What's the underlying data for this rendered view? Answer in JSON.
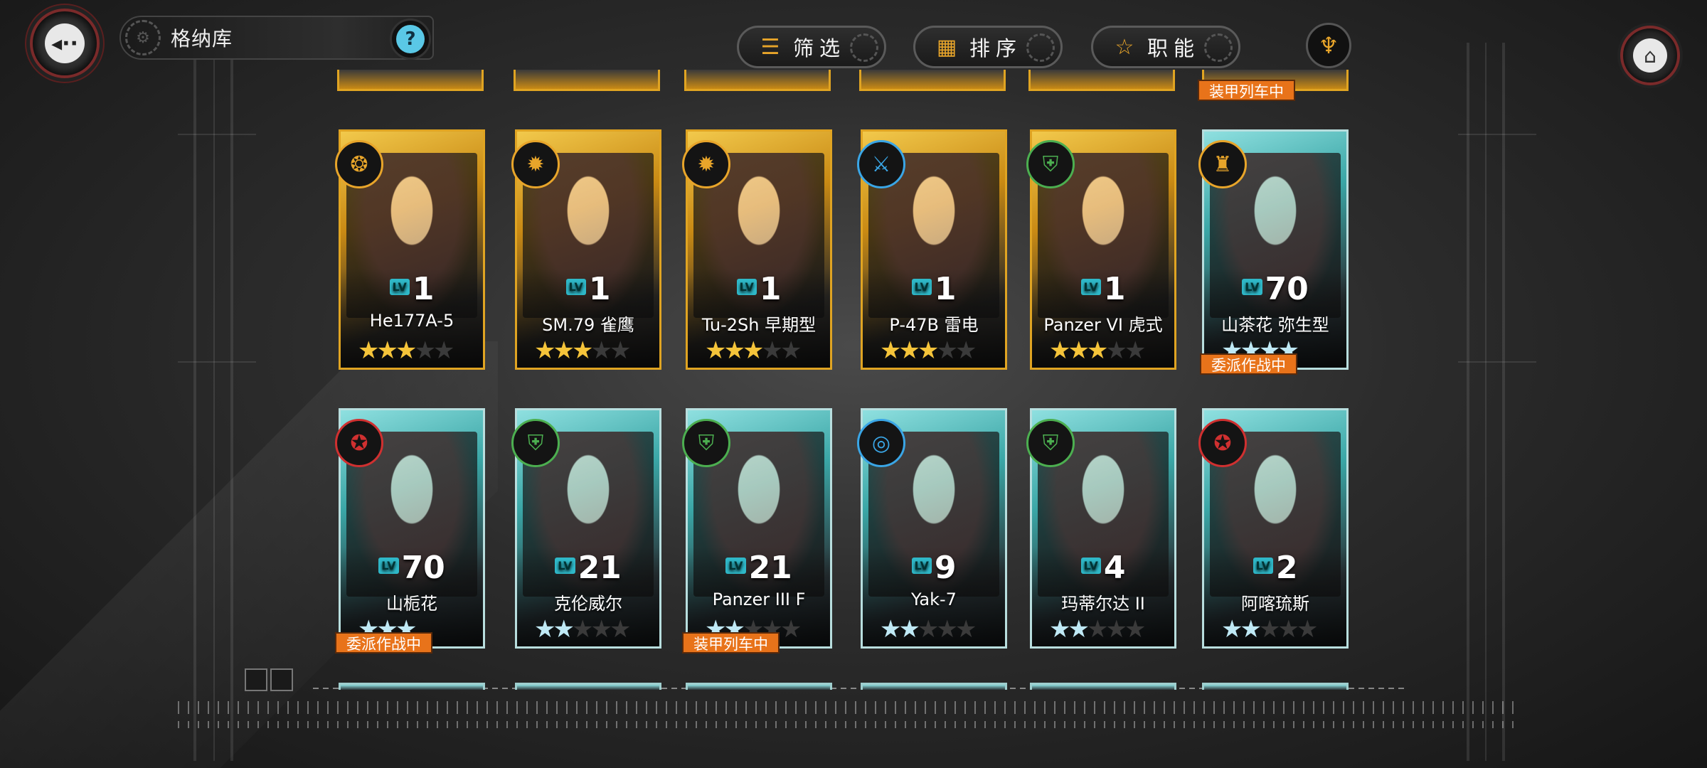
{
  "header": {
    "title": "格纳库",
    "help_label": "?",
    "filter_label": "筛选",
    "sort_label": "排序",
    "role_label": "职能"
  },
  "top_row_badge": "装甲列车中",
  "cards": [
    {
      "level": "1",
      "name": "He177A-5",
      "rarity": 3,
      "max": 5,
      "frame": "gold",
      "class_color": "#e8a52a",
      "class_icon": "❂"
    },
    {
      "level": "1",
      "name": "SM.79 雀鹰",
      "rarity": 3,
      "max": 5,
      "frame": "gold",
      "class_color": "#e8a52a",
      "class_icon": "✹"
    },
    {
      "level": "1",
      "name": "Tu-2Sh 早期型",
      "rarity": 3,
      "max": 5,
      "frame": "gold",
      "class_color": "#e8a52a",
      "class_icon": "✹"
    },
    {
      "level": "1",
      "name": "P-47B 雷电",
      "rarity": 3,
      "max": 5,
      "frame": "gold",
      "class_color": "#3aa6e6",
      "class_icon": "⚔"
    },
    {
      "level": "1",
      "name": "Panzer VI 虎式",
      "rarity": 3,
      "max": 5,
      "frame": "gold",
      "class_color": "#4caf50",
      "class_icon": "⛨"
    },
    {
      "level": "70",
      "name": "山茶花 弥生型",
      "rarity": 4,
      "max": 4,
      "frame": "teal",
      "class_color": "#e8a52a",
      "class_icon": "♜",
      "badge": "委派作战中"
    },
    {
      "level": "70",
      "name": "山栀花",
      "rarity": 3,
      "max": 3,
      "frame": "teal",
      "class_color": "#d03030",
      "class_icon": "✪",
      "badge": "委派作战中"
    },
    {
      "level": "21",
      "name": "克伦威尔",
      "rarity": 2,
      "max": 5,
      "frame": "teal",
      "class_color": "#4caf50",
      "class_icon": "⛨"
    },
    {
      "level": "21",
      "name": "Panzer III F",
      "rarity": 2,
      "max": 5,
      "frame": "teal",
      "class_color": "#4caf50",
      "class_icon": "⛨",
      "badge": "装甲列车中"
    },
    {
      "level": "9",
      "name": "Yak-7",
      "rarity": 2,
      "max": 5,
      "frame": "teal",
      "class_color": "#3aa6e6",
      "class_icon": "◎"
    },
    {
      "level": "4",
      "name": "玛蒂尔达 II",
      "rarity": 2,
      "max": 5,
      "frame": "teal",
      "class_color": "#4caf50",
      "class_icon": "⛨"
    },
    {
      "level": "2",
      "name": "阿喀琉斯",
      "rarity": 2,
      "max": 5,
      "frame": "teal",
      "class_color": "#d03030",
      "class_icon": "✪"
    }
  ],
  "icons": {
    "back": "back-arrow-icon",
    "home": "home-icon",
    "filter": "filter-lines-icon",
    "sort": "grid-icon",
    "role": "star-icon",
    "brand": "brand-emblem-icon"
  }
}
